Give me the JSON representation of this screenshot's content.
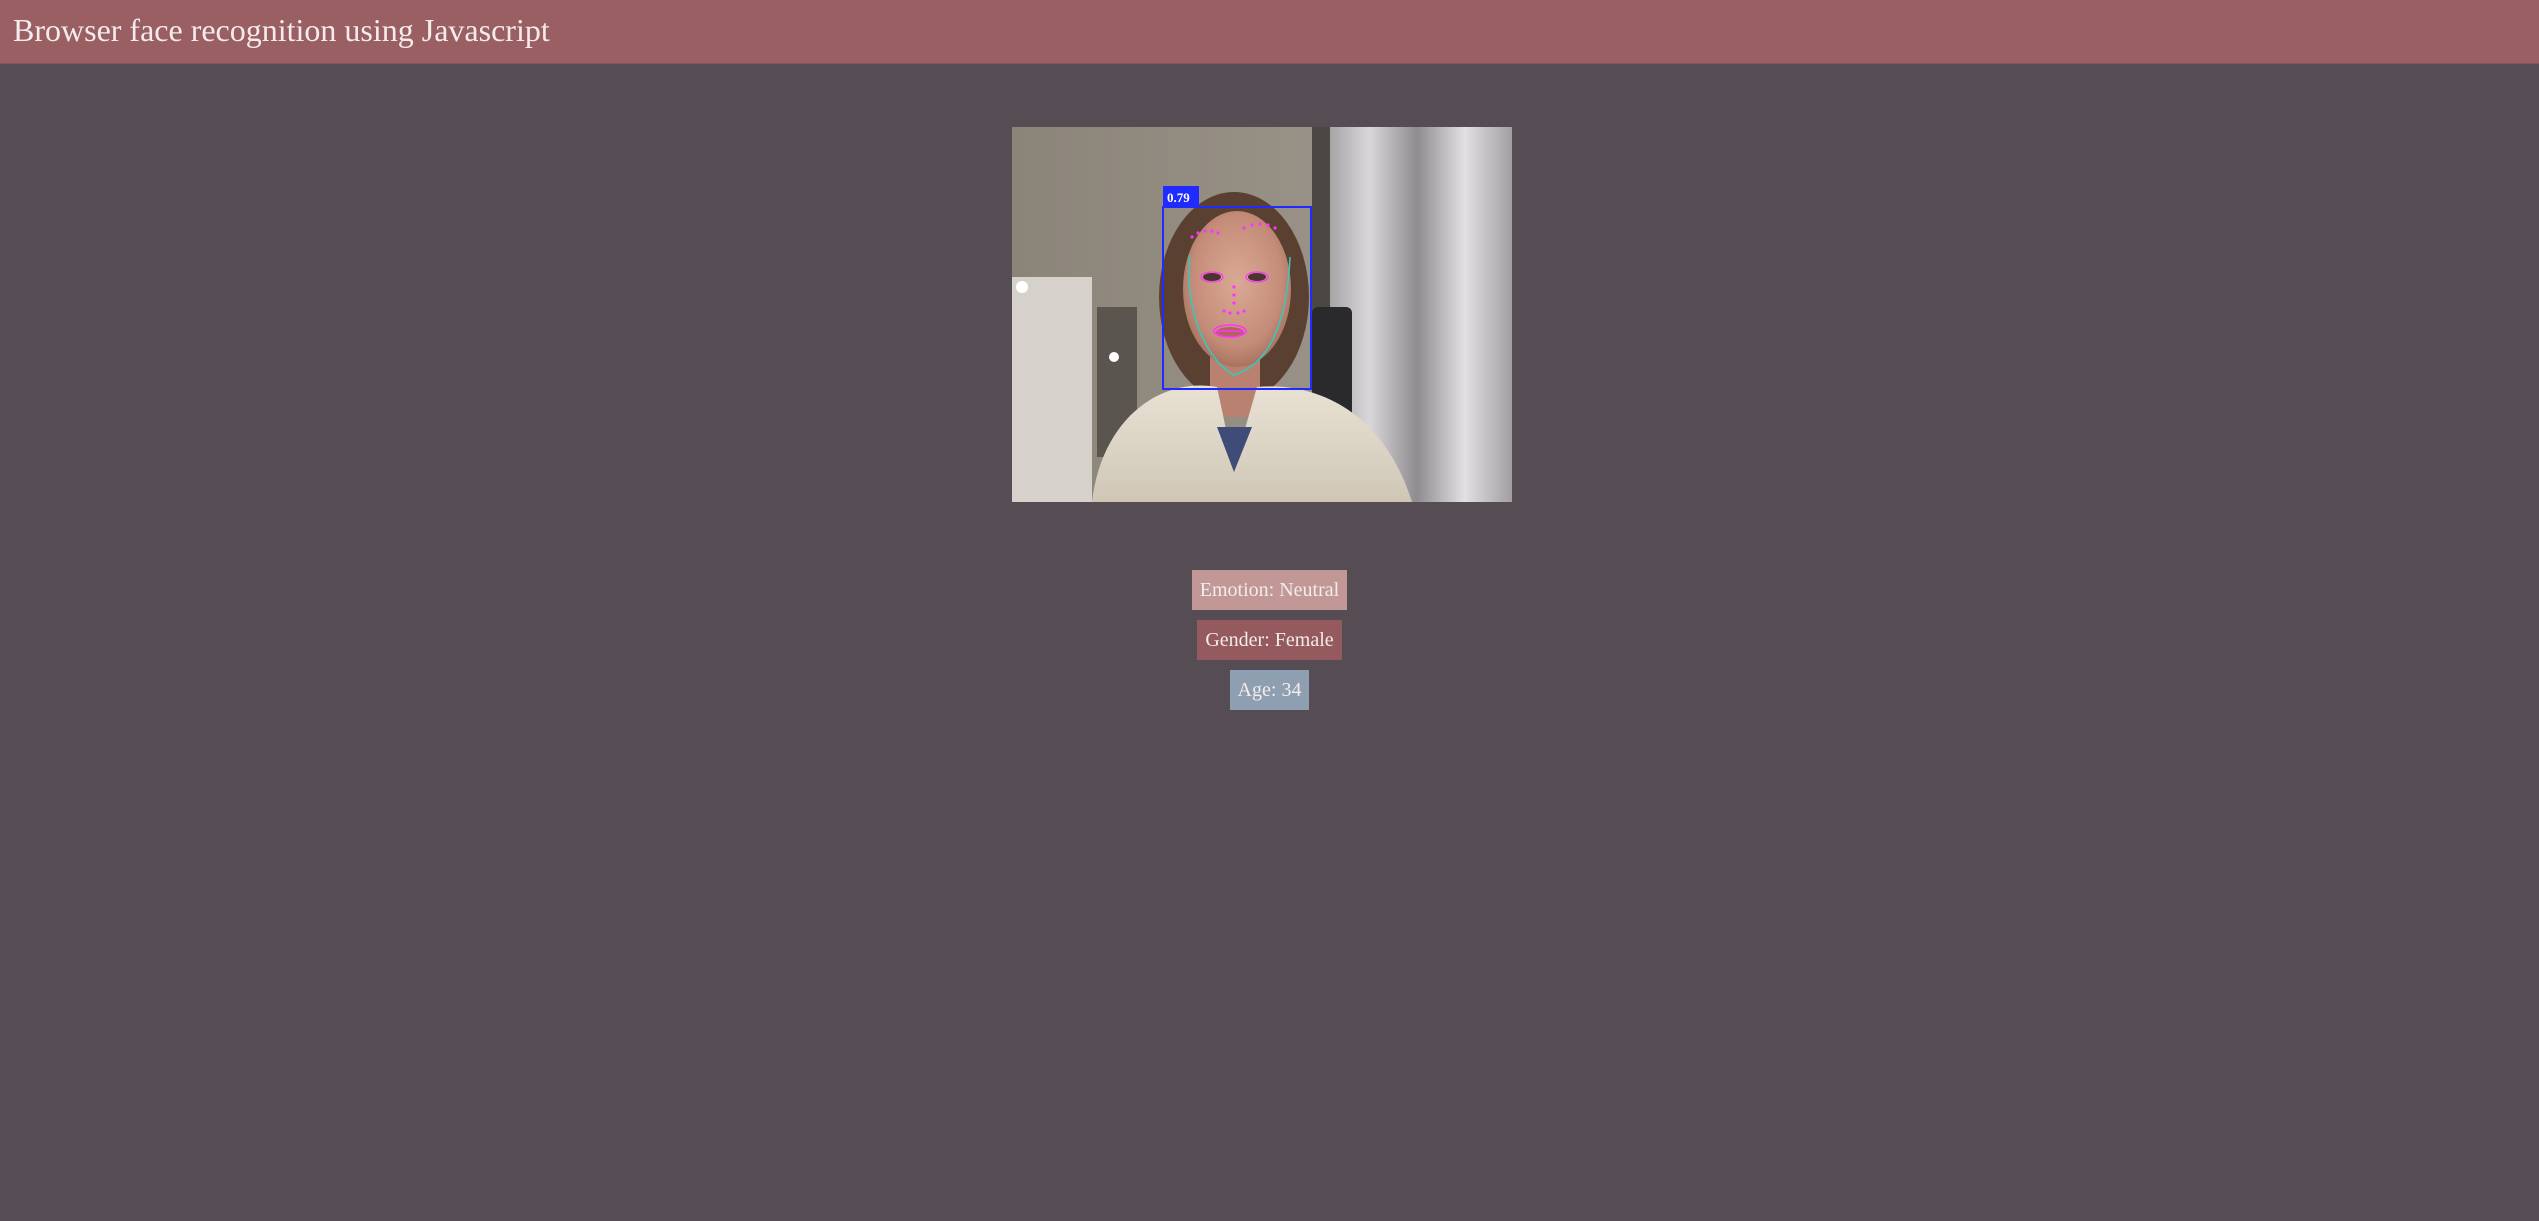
{
  "header": {
    "title": "Browser face recognition using Javascript"
  },
  "detection": {
    "score_label": "0.79"
  },
  "results": {
    "emotion": {
      "label": "Emotion:",
      "value": "Neutral"
    },
    "gender": {
      "label": "Gender:",
      "value": "Female"
    },
    "age": {
      "label": "Age:",
      "value": "34"
    }
  },
  "colors": {
    "header_bg": "#9a5f62",
    "page_bg": "#564d54",
    "emotion_bg": "#c29896",
    "gender_bg": "#955a5e",
    "age_bg": "#8f9fb2",
    "detection_box": "#1f2bff",
    "landmarks": "#ff33ff",
    "jawline": "#35c9c0"
  }
}
